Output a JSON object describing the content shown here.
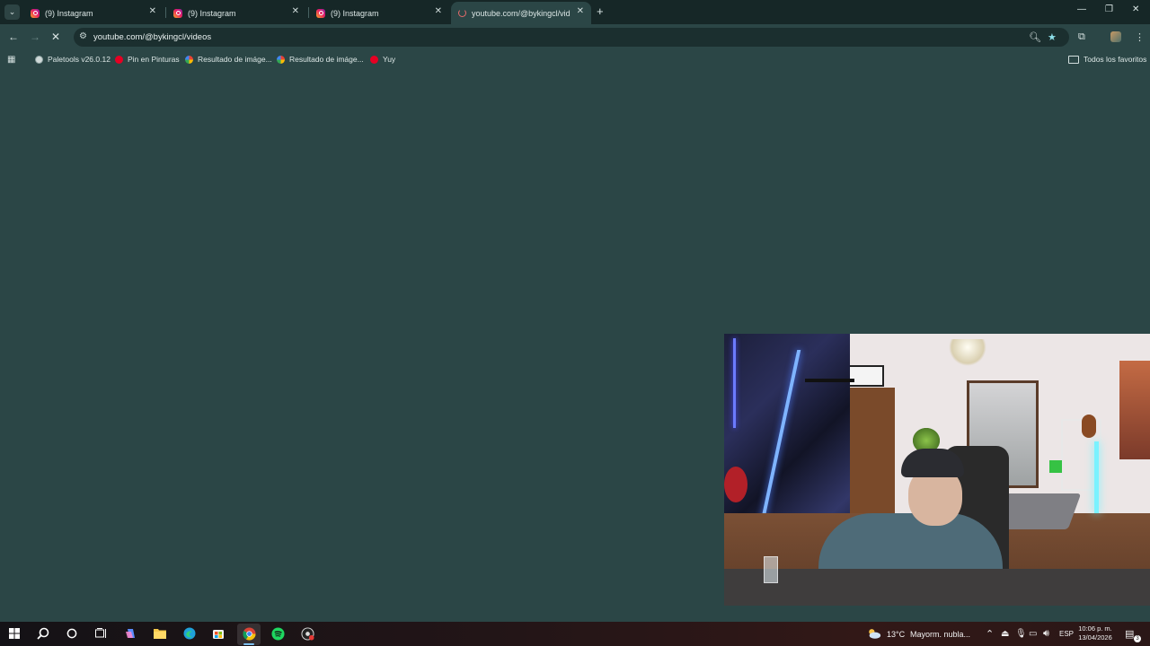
{
  "browser": {
    "tabs": [
      {
        "label": "(9) Instagram",
        "active": false,
        "favicon": "instagram-icon"
      },
      {
        "label": "(9) Instagram",
        "active": false,
        "favicon": "instagram-icon"
      },
      {
        "label": "(9) Instagram",
        "active": false,
        "favicon": "instagram-icon"
      },
      {
        "label": "youtube.com/@bykingcl/video",
        "active": true,
        "favicon": "loading-spinner-icon"
      }
    ],
    "url": "youtube.com/@bykingcl/videos",
    "bookmarks": [
      {
        "label": "Paletools v26.0.12",
        "icon": "globe-icon"
      },
      {
        "label": "Pin en Pinturas",
        "icon": "pinterest-icon"
      },
      {
        "label": "Resultado de imáge...",
        "icon": "google-icon"
      },
      {
        "label": "Resultado de imáge...",
        "icon": "google-icon"
      },
      {
        "label": "Yuy",
        "icon": "pinterest-icon"
      }
    ],
    "all_bookmarks_label": "Todos los favoritos"
  },
  "taskbar": {
    "weather_temp": "13°C",
    "weather_desc": "Mayorm. nubla...",
    "language": "ESP",
    "time": "10:06 p. m.",
    "date": "13/04/2026",
    "notification_count": "3"
  },
  "colors": {
    "page_background": "#2b4646",
    "tabstrip": "#162727",
    "omnibox": "#1b2f2f",
    "star_accent": "#8ee0ea"
  }
}
